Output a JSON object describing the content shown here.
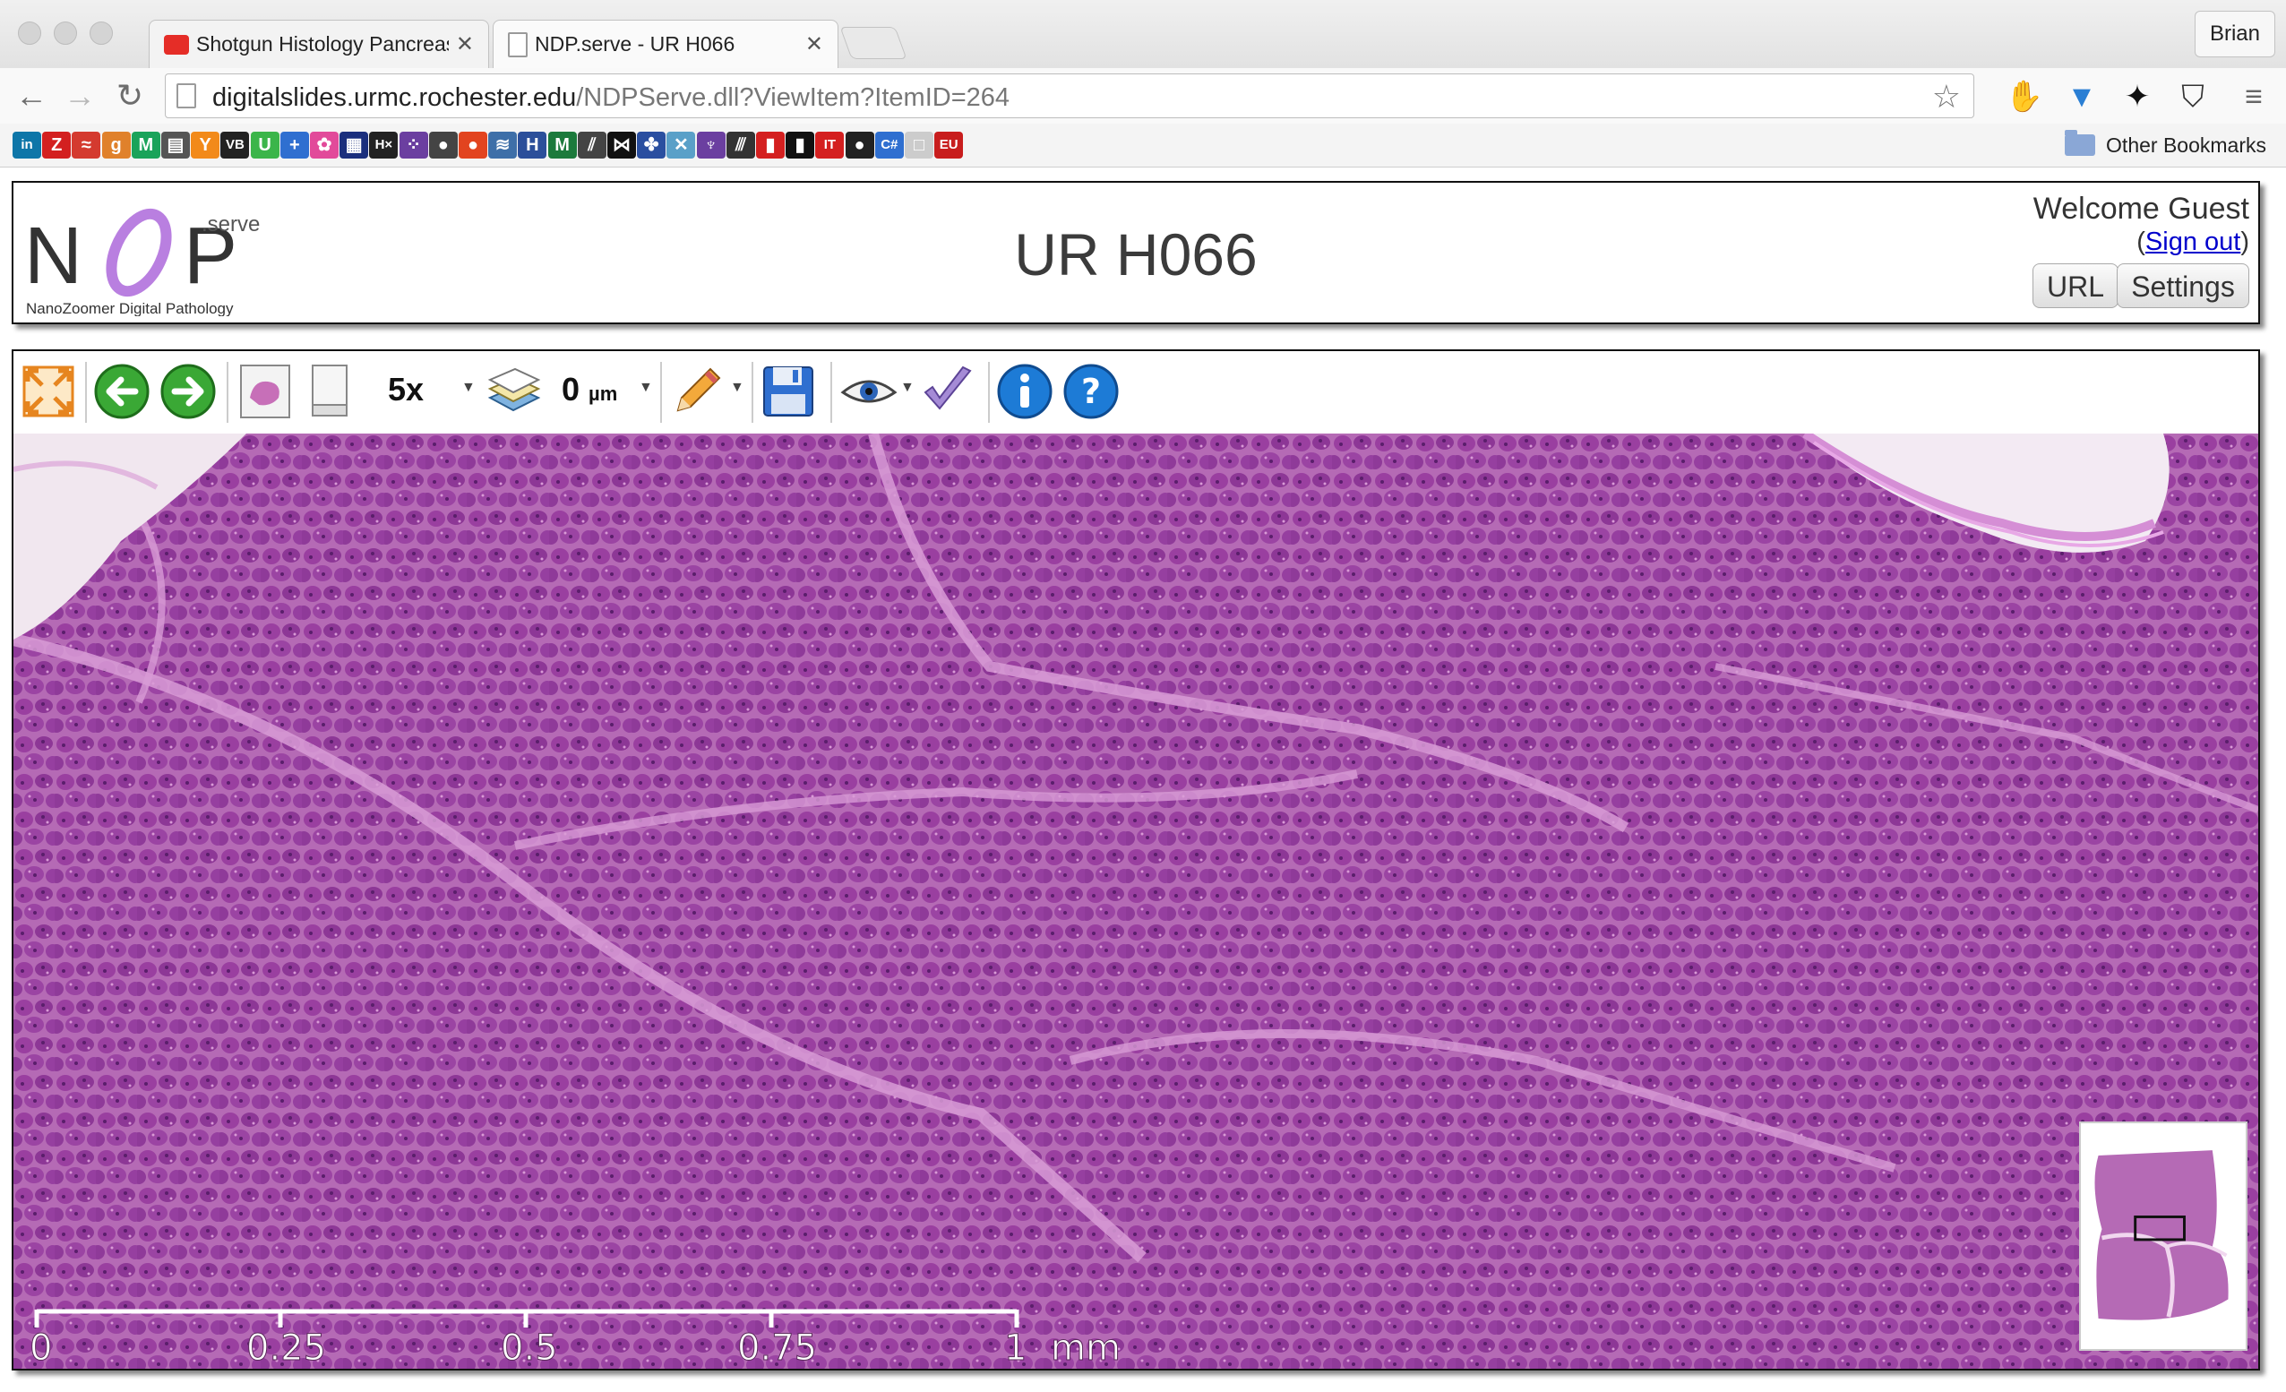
{
  "browser": {
    "tabs": [
      {
        "title": "Shotgun Histology Pancreas",
        "active": false
      },
      {
        "title": "NDP.serve - UR H066",
        "active": true
      }
    ],
    "profile": "Brian",
    "url_host": "digitalslides.urmc.rochester.edu",
    "url_path": "/NDPServe.dll?ViewItem?ItemID=264",
    "bookmarks_other": "Other Bookmarks",
    "bookmark_glyphs": [
      "in",
      "Z",
      "≈",
      "g",
      "M",
      "▤",
      "Y",
      "VB",
      "U",
      "+",
      "✿",
      "▦",
      "H×",
      "⁘",
      "●",
      "●",
      "≋",
      "H",
      "M",
      "⫽",
      "⋈",
      "✤",
      "✕",
      "♆",
      "⫻",
      "▮",
      "▮",
      "IT",
      "●",
      "C#",
      "□",
      "EU"
    ]
  },
  "header": {
    "logo_word": "NDP",
    "logo_serve": ".serve",
    "logo_tagline": "NanoZoomer Digital Pathology",
    "title": "UR H066",
    "welcome": "Welcome Guest",
    "sign_out": "Sign out",
    "url_button": "URL",
    "settings_button": "Settings"
  },
  "viewer": {
    "magnification": "5x",
    "focus_value": "0",
    "focus_unit": "µm",
    "scale_labels": [
      "0",
      "0.25",
      "0.5",
      "0.75",
      "1"
    ],
    "scale_unit": "mm"
  },
  "colors": {
    "tissue": "#a04aa8",
    "tissue_light": "#c77cc6",
    "accent_green": "#3aa835",
    "accent_blue": "#1d7bd6"
  }
}
